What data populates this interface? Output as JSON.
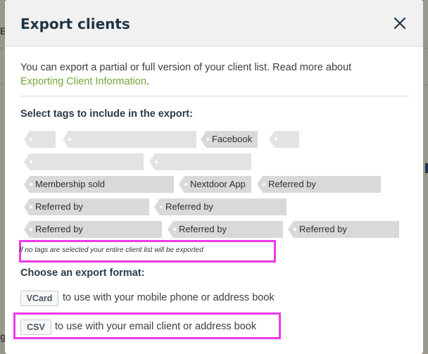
{
  "background": {
    "letter_top": "E",
    "letter_bottom": "g"
  },
  "modal": {
    "title": "Export clients",
    "close_icon": "close-icon",
    "intro_text": "You can export a partial or full version of your client list. Read more about",
    "intro_link": "Exporting Client Information",
    "intro_end": ".",
    "tags_label": "Select tags to include in the export:",
    "tags": [
      "",
      "",
      "Facebook",
      "",
      "",
      "",
      "Membership sold",
      "Nextdoor App",
      "Referred by",
      "Referred by",
      "Referred by",
      "Referred by",
      "Referred by",
      "Referred by"
    ],
    "hint": "If no tags are selected your entire client list will be exported",
    "format_label": "Choose an export format:",
    "vcard_button": "VCard",
    "vcard_text": "to use with your mobile phone or address book",
    "csv_button": "CSV",
    "csv_text": "to use with your email client or address book"
  },
  "colors": {
    "link": "#76a53b",
    "title": "#1e3445",
    "highlight": "#ec3ae6",
    "tag_bg": "#d9d9d9"
  }
}
